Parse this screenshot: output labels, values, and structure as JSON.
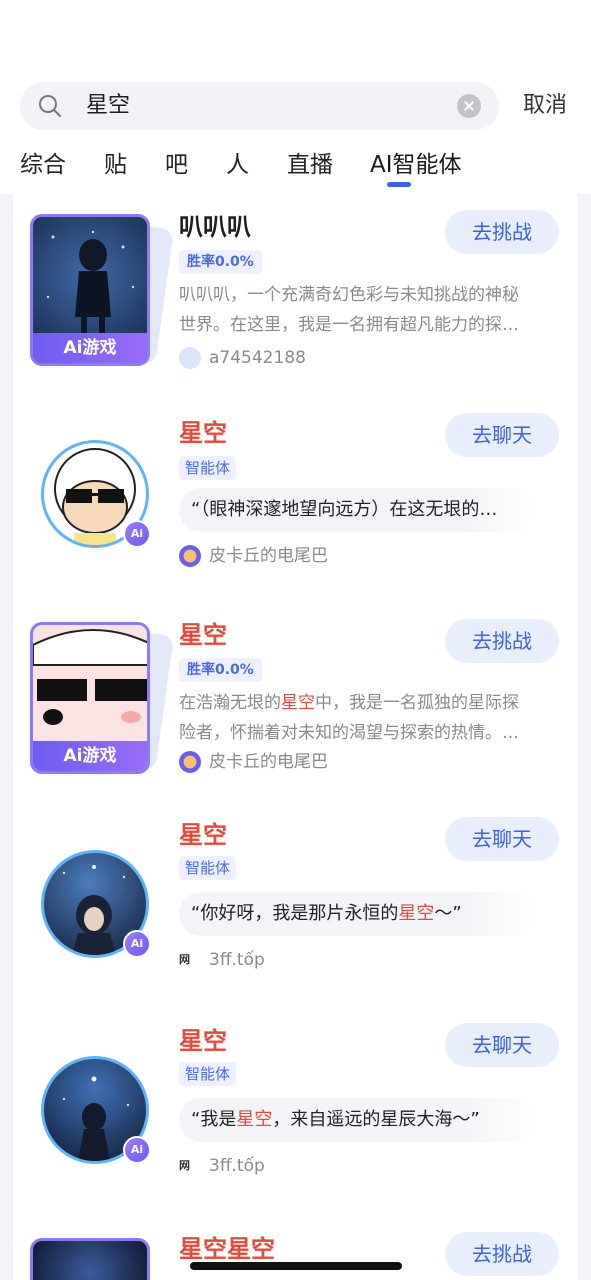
{
  "search": {
    "query": "星空",
    "cancel_label": "取消"
  },
  "tabs": [
    {
      "label": "综合"
    },
    {
      "label": "贴"
    },
    {
      "label": "吧"
    },
    {
      "label": "人"
    },
    {
      "label": "直播"
    },
    {
      "label": "AI智能体",
      "active": true
    }
  ],
  "results": [
    {
      "type": "game",
      "title": "叭叭叭",
      "winrate": "胜率0.0%",
      "desc_line1": "叭叭叭，一个充满奇幻色彩与未知挑战的神秘",
      "desc_line2": "世界。在这里，我是一名拥有超凡能力的探…",
      "author": "a74542188",
      "game_tag": "游戏",
      "action": "去挑战"
    },
    {
      "type": "agent",
      "title": "星空",
      "tag": "智能体",
      "quote": "“（眼神深邃地望向远方）在这无垠的…",
      "author": "皮卡丘的电尾巴",
      "action": "去聊天"
    },
    {
      "type": "game",
      "title": "星空",
      "winrate": "胜率0.0%",
      "desc_line1_pre": "在浩瀚无垠的",
      "desc_line1_hl": "星空",
      "desc_line1_post": "中，我是一名孤独的星际探",
      "desc_line2": "险者，怀揣着对未知的渴望与探索的热情。…",
      "author": "皮卡丘的电尾巴",
      "game_tag": "游戏",
      "action": "去挑战"
    },
    {
      "type": "agent",
      "title": "星空",
      "tag": "智能体",
      "quote_pre": "“你好呀，我是那片永恒的",
      "quote_hl": "星空",
      "quote_post": "～”",
      "author": "3ff.tốp",
      "action": "去聊天"
    },
    {
      "type": "agent",
      "title": "星空",
      "tag": "智能体",
      "quote_pre": "“我是",
      "quote_hl": "星空",
      "quote_post": "，来自遥远的星辰大海～”",
      "author": "3ff.tốp",
      "action": "去聊天"
    },
    {
      "type": "game",
      "title": "星空星空",
      "action": "去挑战"
    }
  ],
  "colors": {
    "accent": "#3b62e0",
    "highlight": "#e64a3c",
    "ai_purple": "#7a62f3"
  }
}
